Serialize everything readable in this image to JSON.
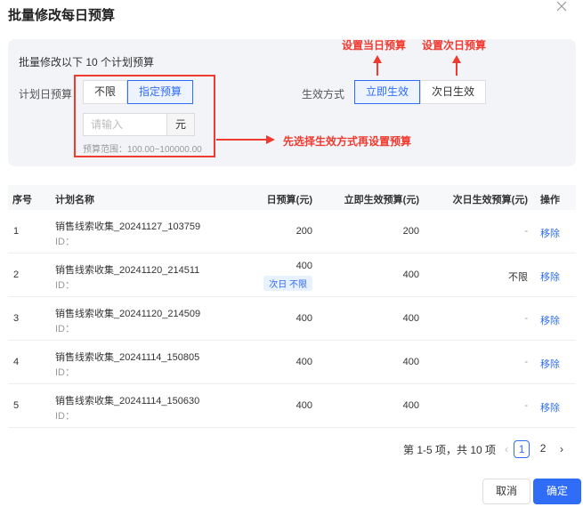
{
  "dialog": {
    "title": "批量修改每日预算"
  },
  "settings": {
    "description": "批量修改以下 10 个计划预算",
    "budget_label": "计划日预算",
    "budget_options": [
      "不限",
      "指定预算"
    ],
    "budget_selected": "指定预算",
    "input_placeholder": "请输入",
    "input_unit": "元",
    "range_text": "预算范围：100.00~100000.00",
    "effect_label": "生效方式",
    "effect_options": [
      "立即生效",
      "次日生效"
    ],
    "effect_selected": "立即生效"
  },
  "annotations": {
    "today": "设置当日预算",
    "tomorrow": "设置次日预算",
    "hint": "先选择生效方式再设置预算",
    "color": "#f03a2f"
  },
  "table": {
    "headers": {
      "index": "序号",
      "name": "计划名称",
      "daily": "日预算(元)",
      "immediate": "立即生效预算(元)",
      "nextday": "次日生效预算(元)",
      "action": "操作"
    },
    "rows": [
      {
        "index": "1",
        "name": "销售线索收集_20241127_103759",
        "id": "ID：",
        "daily": "200",
        "badge": "",
        "immediate": "200",
        "nextday": "-",
        "action": "移除"
      },
      {
        "index": "2",
        "name": "销售线索收集_20241120_214511",
        "id": "ID：",
        "daily": "400",
        "badge": "次日 不限",
        "immediate": "400",
        "nextday": "不限",
        "action": "移除"
      },
      {
        "index": "3",
        "name": "销售线索收集_20241120_214509",
        "id": "ID：",
        "daily": "400",
        "badge": "",
        "immediate": "400",
        "nextday": "-",
        "action": "移除"
      },
      {
        "index": "4",
        "name": "销售线索收集_20241114_150805",
        "id": "ID：",
        "daily": "400",
        "badge": "",
        "immediate": "400",
        "nextday": "-",
        "action": "移除"
      },
      {
        "index": "5",
        "name": "销售线索收集_20241114_150630",
        "id": "ID：",
        "daily": "400",
        "badge": "",
        "immediate": "400",
        "nextday": "-",
        "action": "移除"
      }
    ]
  },
  "pagination": {
    "summary": "第 1-5 项，共 10 项",
    "pages": [
      "1",
      "2"
    ],
    "current": "1"
  },
  "footer": {
    "cancel": "取消",
    "confirm": "确定"
  },
  "colors": {
    "accent": "#2f6df6",
    "annotation": "#f03a2f"
  }
}
